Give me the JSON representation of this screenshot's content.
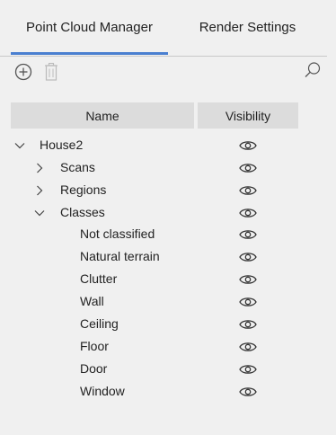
{
  "tabs": [
    {
      "label": "Point Cloud Manager",
      "active": true
    },
    {
      "label": "Render Settings",
      "active": false
    }
  ],
  "toolbar": {
    "add_icon": "add-circle-icon",
    "delete_icon": "trash-icon",
    "search_icon": "search-icon"
  },
  "table": {
    "headers": {
      "name": "Name",
      "visibility": "Visibility"
    },
    "rows": [
      {
        "label": "House2",
        "level": 0,
        "expander": "expanded",
        "visible": true
      },
      {
        "label": "Scans",
        "level": 1,
        "expander": "collapsed",
        "visible": true
      },
      {
        "label": "Regions",
        "level": 1,
        "expander": "collapsed",
        "visible": true
      },
      {
        "label": "Classes",
        "level": 1,
        "expander": "expanded",
        "visible": true
      },
      {
        "label": "Not classified",
        "level": 2,
        "expander": "none",
        "visible": true
      },
      {
        "label": "Natural terrain",
        "level": 2,
        "expander": "none",
        "visible": true
      },
      {
        "label": "Clutter",
        "level": 2,
        "expander": "none",
        "visible": true
      },
      {
        "label": "Wall",
        "level": 2,
        "expander": "none",
        "visible": true
      },
      {
        "label": "Ceiling",
        "level": 2,
        "expander": "none",
        "visible": true
      },
      {
        "label": "Floor",
        "level": 2,
        "expander": "none",
        "visible": true
      },
      {
        "label": "Door",
        "level": 2,
        "expander": "none",
        "visible": true
      },
      {
        "label": "Window",
        "level": 2,
        "expander": "none",
        "visible": true
      }
    ]
  },
  "colors": {
    "accent": "#4a7fd0",
    "header_bg": "#dcdcdc",
    "panel_bg": "#f0f0f0"
  }
}
